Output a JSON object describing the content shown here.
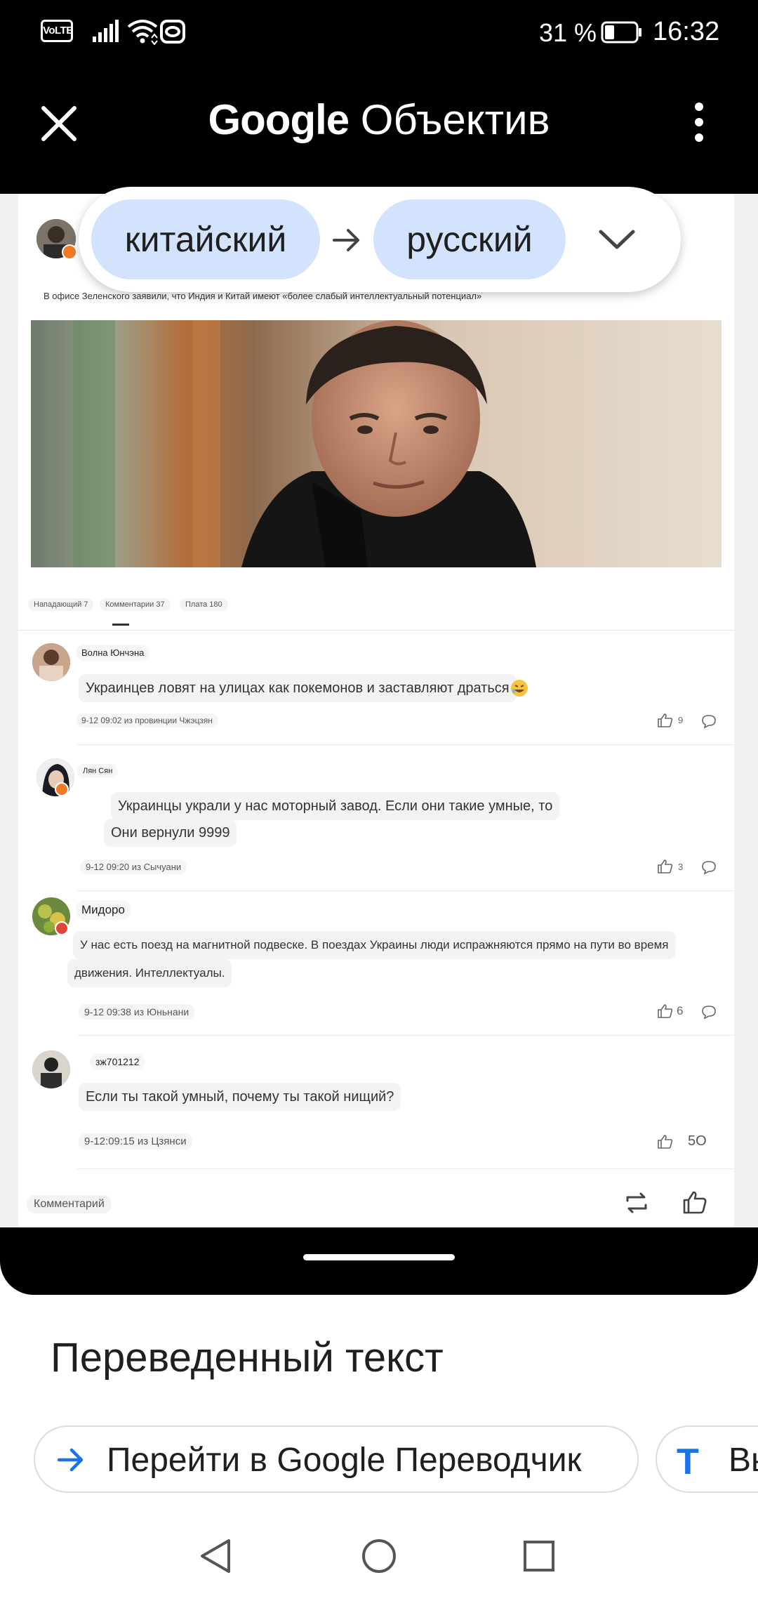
{
  "status_bar": {
    "volte": "VoLTE",
    "battery_pct": "31 %",
    "battery_level": 0.31,
    "time": "16:32"
  },
  "header": {
    "title_google": "Google",
    "title_lens": " Объектив",
    "close_icon": "close-icon",
    "more_icon": "more-vert-icon"
  },
  "language": {
    "from": "китайский",
    "to": "русский"
  },
  "article": {
    "headline": "В офисе Зеленского заявили, что Индия и Китай имеют «более слабый интеллектуальный потенциал»"
  },
  "tabs": [
    {
      "label": "Нападающий 7"
    },
    {
      "label": "Комментарии 37"
    },
    {
      "label": "Плата 180"
    }
  ],
  "comments": [
    {
      "name": "Волна Юнчэна",
      "text": "Украинцев ловят на улицах как покемонов и заставляют драться",
      "meta": "9-12 09:02 из провинции Чжэцзян",
      "likes": "9"
    },
    {
      "name": "Лян Сян",
      "text_line1": "Украинцы украли у нас моторный завод. Если они такие умные, то",
      "text_line2": "Они вернули 9999",
      "meta": "9-12 09:20 из Сычуани",
      "likes": "3"
    },
    {
      "name": "Мидоро",
      "text_line1": "У нас есть поезд на магнитной подвеске. В поездах Украины люди испражняются прямо на пути во время",
      "text_line2": "движения. Интеллектуалы.",
      "meta": "9-12 09:38 из Юньнани",
      "likes": "6"
    },
    {
      "name": "зж701212",
      "text": "Если ты такой умный, почему ты такой нищий?",
      "meta": "9-12:09:15 из Цзянси",
      "likes": "5О"
    }
  ],
  "bottom_bar": {
    "comment_placeholder": "Комментарий"
  },
  "translated": {
    "title": "Переведенный текст",
    "open_translate": "Перейти в Google Переводчик",
    "second_button": "Вы"
  },
  "colors": {
    "chip": "#d3e3fd",
    "accent": "#1a73e8"
  }
}
